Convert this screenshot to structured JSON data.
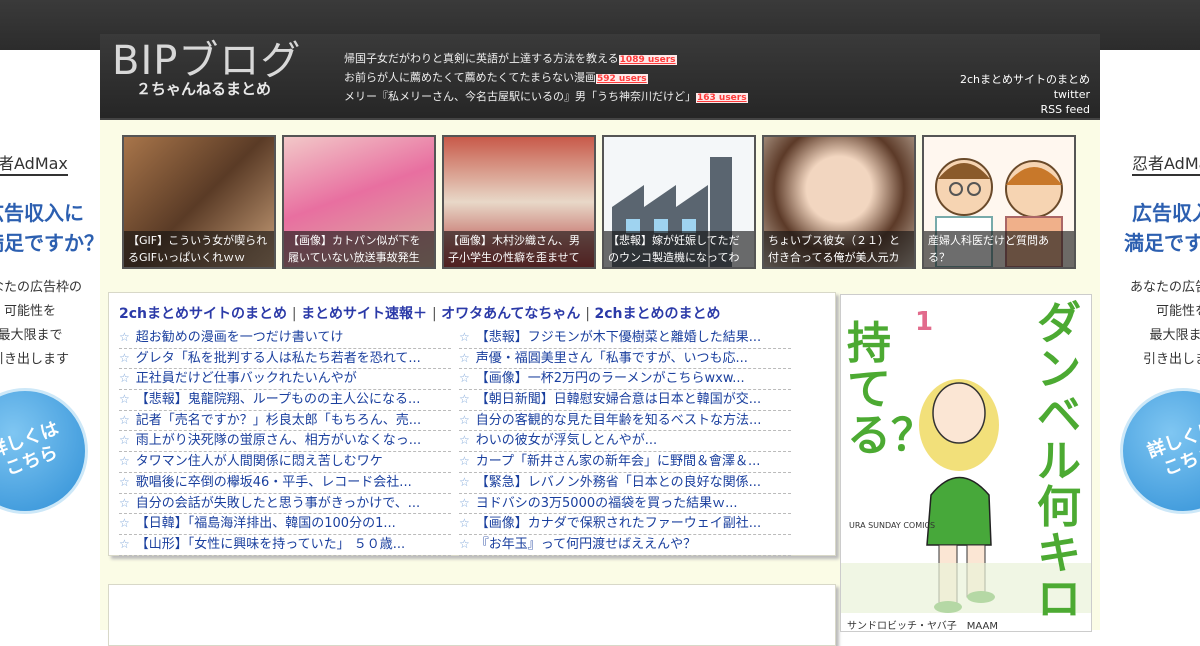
{
  "header": {
    "brand_title": "BIPブログ",
    "brand_sub": "２ちゃんねるまとめ",
    "news": [
      {
        "text": "帰国子女だがわりと真剣に英語が上達する方法を教える",
        "badge": "1089 users"
      },
      {
        "text": "お前らが人に薦めたくて薦めたくてたまらない漫画",
        "badge": "592 users"
      },
      {
        "text": "メリー『私メリーさん、今名古屋駅にいるの』男「うち神奈川だけど」",
        "badge": "163 users"
      }
    ],
    "links": [
      "2chまとめサイトのまとめ",
      "twitter",
      "RSS feed"
    ]
  },
  "thumbs": [
    {
      "caption": "【GIF】こういう女が喫られるGIFいっぱいくれｗｗ"
    },
    {
      "caption": "【画像】カトパン似が下を履いていない放送事故発生"
    },
    {
      "caption": "【画像】木村沙織さん、男子小学生の性癖を歪ませて"
    },
    {
      "caption": "【悲報】嫁が妊娠してただのウンコ製造機になってわ"
    },
    {
      "caption": "ちょいブス彼女（２１）と付き合ってる俺が美人元カ"
    },
    {
      "caption": "産婦人科医だけど質問ある？"
    }
  ],
  "rss": {
    "nav": [
      "2chまとめサイトのまとめ",
      "まとめサイト速報＋",
      "オワタあんてなちゃん",
      "2chまとめのまとめ"
    ],
    "left": [
      "超お勧めの漫画を一つだけ書いてけ",
      "グレタ「私を批判する人は私たち若者を恐れて...",
      "正社員だけど仕事バックれたいんやが",
      "【悲報】鬼龍院翔、ループものの主人公になる...",
      "記者「売名ですか？」杉良太郎「もちろん、売...",
      "雨上がり決死隊の蛍原さん、相方がいなくなっ...",
      "タワマン住人が人間関係に悶え苦しむワケ",
      "歌唱後に卒倒の欅坂46・平手、レコード会社...",
      "自分の会話が失敗したと思う事がきっかけで、...",
      "【日韓】「福島海洋排出、韓国の100分の1...",
      "【山形】「女性に興味を持っていた」 ５０歳..."
    ],
    "right": [
      "【悲報】フジモンが木下優樹菜と離婚した結果...",
      "声優・福圓美里さん「私事ですが、いつも応...",
      "【画像】一杯2万円のラーメンがこちらwxw...",
      "【朝日新聞】日韓慰安婦合意は日本と韓国が交...",
      "自分の客観的な見た目年齢を知るベストな方法...",
      "わいの彼女が浮気しとんやが...",
      "カープ「新井さん家の新年会」に野間＆會澤＆...",
      "【緊急】レバノン外務省「日本との良好な関係...",
      "ヨドバシの3万5000の福袋を買った結果ｗ...",
      "【画像】カナダで保釈されたファーウェイ副社...",
      "『お年玉』って何円渡せばええんや？"
    ]
  },
  "ads": {
    "logo": "忍者AdMax",
    "headline": [
      "広告収入に",
      "満足ですか？"
    ],
    "body": [
      "あなたの広告枠の",
      "可能性を",
      "最大限まで",
      "引き出します"
    ],
    "cta": "詳しくは こちら"
  },
  "manga": {
    "title_left": "持てる？",
    "title_right": "ダンベル何キロ",
    "volume": "1",
    "imprint": "URA SUNDAY COMICS",
    "author": "サンドロビッチ・ヤバ子　MAAM"
  }
}
